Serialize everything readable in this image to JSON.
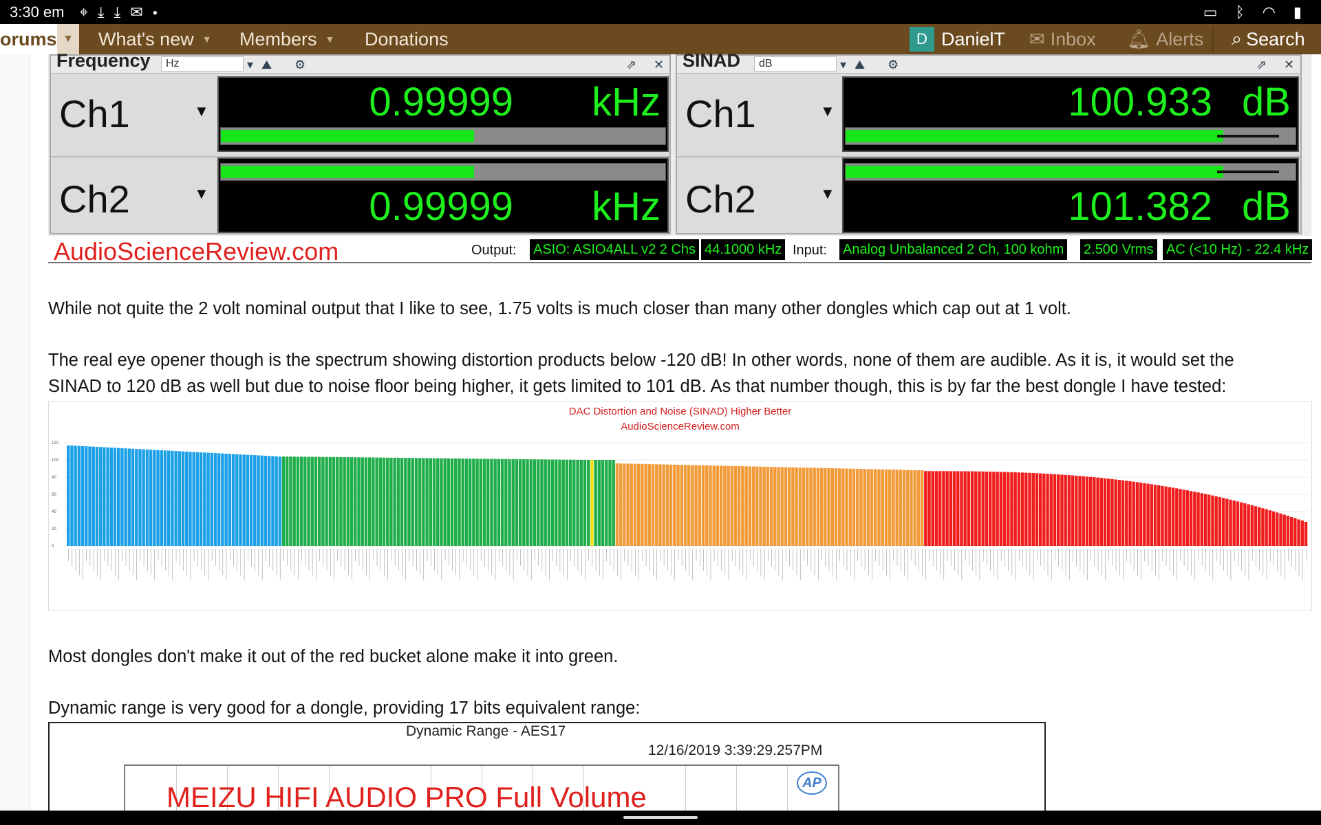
{
  "status_bar": {
    "time": "3:30 em",
    "left_icons": [
      "location-icon",
      "download-icon",
      "download-icon",
      "gmail-icon",
      "dot"
    ],
    "right_icons": [
      "cast-icon",
      "bluetooth-icon",
      "wifi-icon",
      "battery-icon"
    ]
  },
  "nav": {
    "forums_label": "orums",
    "items": [
      {
        "label": "What's new",
        "has_dropdown": true
      },
      {
        "label": "Members",
        "has_dropdown": true
      },
      {
        "label": "Donations",
        "has_dropdown": false
      }
    ],
    "user": {
      "avatar_letter": "D",
      "name": "DanielT"
    },
    "inbox_label": "Inbox",
    "alerts_label": "Alerts",
    "search_label": "Search"
  },
  "ap_panel": {
    "frequency": {
      "title": "Frequency",
      "unit": "Hz",
      "ch1": {
        "label": "Ch1",
        "value": "0.99999",
        "unit": "kHz",
        "level": 0.57
      },
      "ch2": {
        "label": "Ch2",
        "value": "0.99999",
        "unit": "kHz",
        "level": 0.57
      }
    },
    "sinad": {
      "title": "SINAD",
      "unit": "dB",
      "ch1": {
        "label": "Ch1",
        "value": "100.933",
        "unit": "dB",
        "level": 0.84
      },
      "ch2": {
        "label": "Ch2",
        "value": "101.382",
        "unit": "dB",
        "level": 0.84
      }
    },
    "footer": {
      "brand": "AudioScienceReview.com",
      "output_label": "Output:",
      "output_device": "ASIO: ASIO4ALL v2 2 Chs",
      "output_rate": "44.1000 kHz",
      "input_label": "Input:",
      "input_device": "Analog Unbalanced 2 Ch, 100 kohm",
      "input_level": "2.500 Vrms",
      "input_coupling": "AC (<10 Hz) - 22.4 kHz"
    }
  },
  "paragraphs": {
    "p1": "While not quite the 2 volt nominal output that I like to see, 1.75 volts is much closer than many other dongles which cap out at 1 volt.",
    "p2_line1": "The real eye opener though is the spectrum showing distortion products below -120 dB! In other words, none of them are audible. As it is, it would set the",
    "p2_line2": "SINAD to 120 dB as well but due to noise floor being higher, it gets limited to 101 dB. As that number though, this is by far the best dongle I have tested:",
    "p3": "Most dongles don't make it out of the red bucket alone make it into green.",
    "p4": "Dynamic range is very good for a dongle, providing 17 bits equivalent range:"
  },
  "chart_data": {
    "type": "bar",
    "title": "DAC Distortion and Noise (SINAD) Higher Better",
    "subtitle": "AudioScienceReview.com",
    "ylim": [
      0,
      120
    ],
    "yticks": [
      0,
      20,
      40,
      60,
      80,
      100,
      120
    ],
    "grid": true,
    "buckets": [
      {
        "color": "#1ba0e8",
        "count": 60,
        "start": 117,
        "end": 104
      },
      {
        "color": "#1fad49",
        "count": 86,
        "start": 104,
        "end": 100
      },
      {
        "color": "#f5df16",
        "count": 1,
        "start": 100,
        "end": 100
      },
      {
        "color": "#1fad49",
        "count": 6,
        "start": 100,
        "end": 100
      },
      {
        "color": "#f29a38",
        "count": 86,
        "start": 96,
        "end": 88
      },
      {
        "color": "#f01c1c",
        "count": 107,
        "start": 87,
        "end": 28
      }
    ],
    "highlight_index": 146
  },
  "dynamic_range": {
    "title": "Dynamic Range - AES17",
    "timestamp": "12/16/2019 3:39:29.257PM",
    "graph_title": "MEIZU HIFI AUDIO PRO Full Volume",
    "logo": "AP"
  }
}
